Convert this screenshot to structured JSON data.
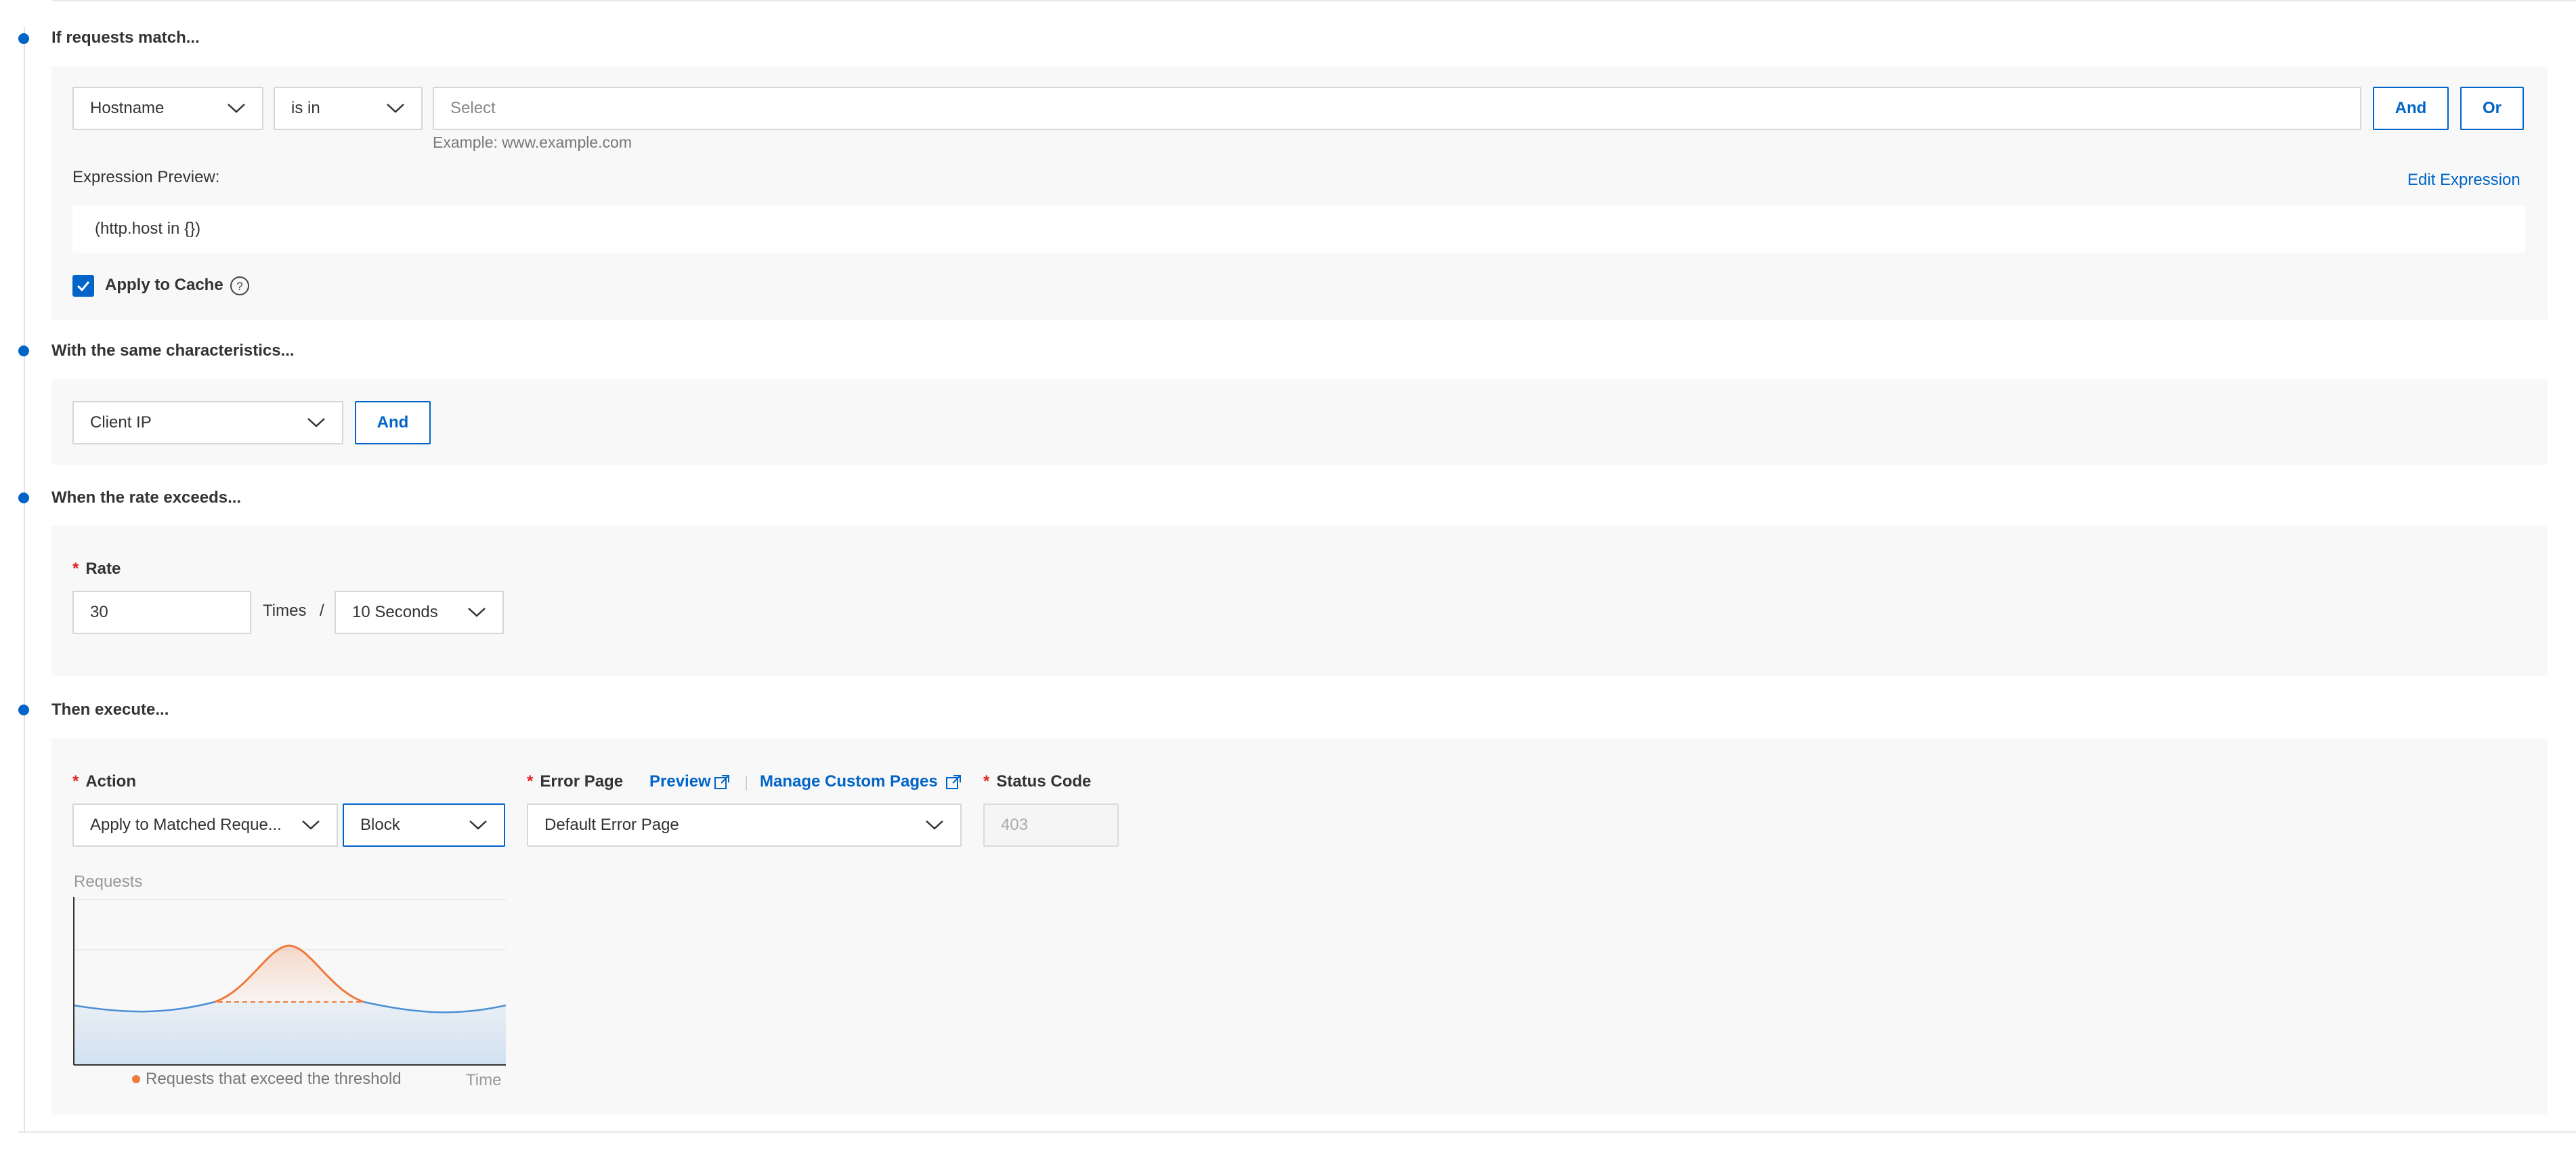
{
  "sections": {
    "match": {
      "title": "If requests match...",
      "field_select": "Hostname",
      "operator_select": "is in",
      "value_placeholder": "Select",
      "and_label": "And",
      "or_label": "Or",
      "example_hint": "Example: www.example.com",
      "preview_label": "Expression Preview:",
      "edit_expression": "Edit Expression",
      "expression": "(http.host in {})",
      "apply_cache_label": "Apply to Cache",
      "apply_cache_checked": true
    },
    "characteristics": {
      "title": "With the same characteristics...",
      "select": "Client IP",
      "and_label": "And"
    },
    "rate": {
      "title": "When the rate exceeds...",
      "rate_label": "Rate",
      "rate_value": "30",
      "times_label": "Times",
      "slash": "/",
      "period_select": "10 Seconds"
    },
    "execute": {
      "title": "Then execute...",
      "action_label": "Action",
      "action_scope_select": "Apply to Matched Reque...",
      "action_select": "Block",
      "error_page_label": "Error Page",
      "preview_link": "Preview",
      "manage_link": "Manage Custom Pages",
      "error_page_select": "Default Error Page",
      "status_code_label": "Status Code",
      "status_code_value": "403"
    }
  },
  "chart_data": {
    "type": "area",
    "ylabel": "Requests",
    "xlabel": "Time",
    "legend": [
      "Requests that exceed the threshold"
    ],
    "colors": {
      "baseline": "#4a8fd6",
      "exceed": "#ef7a3c"
    }
  }
}
